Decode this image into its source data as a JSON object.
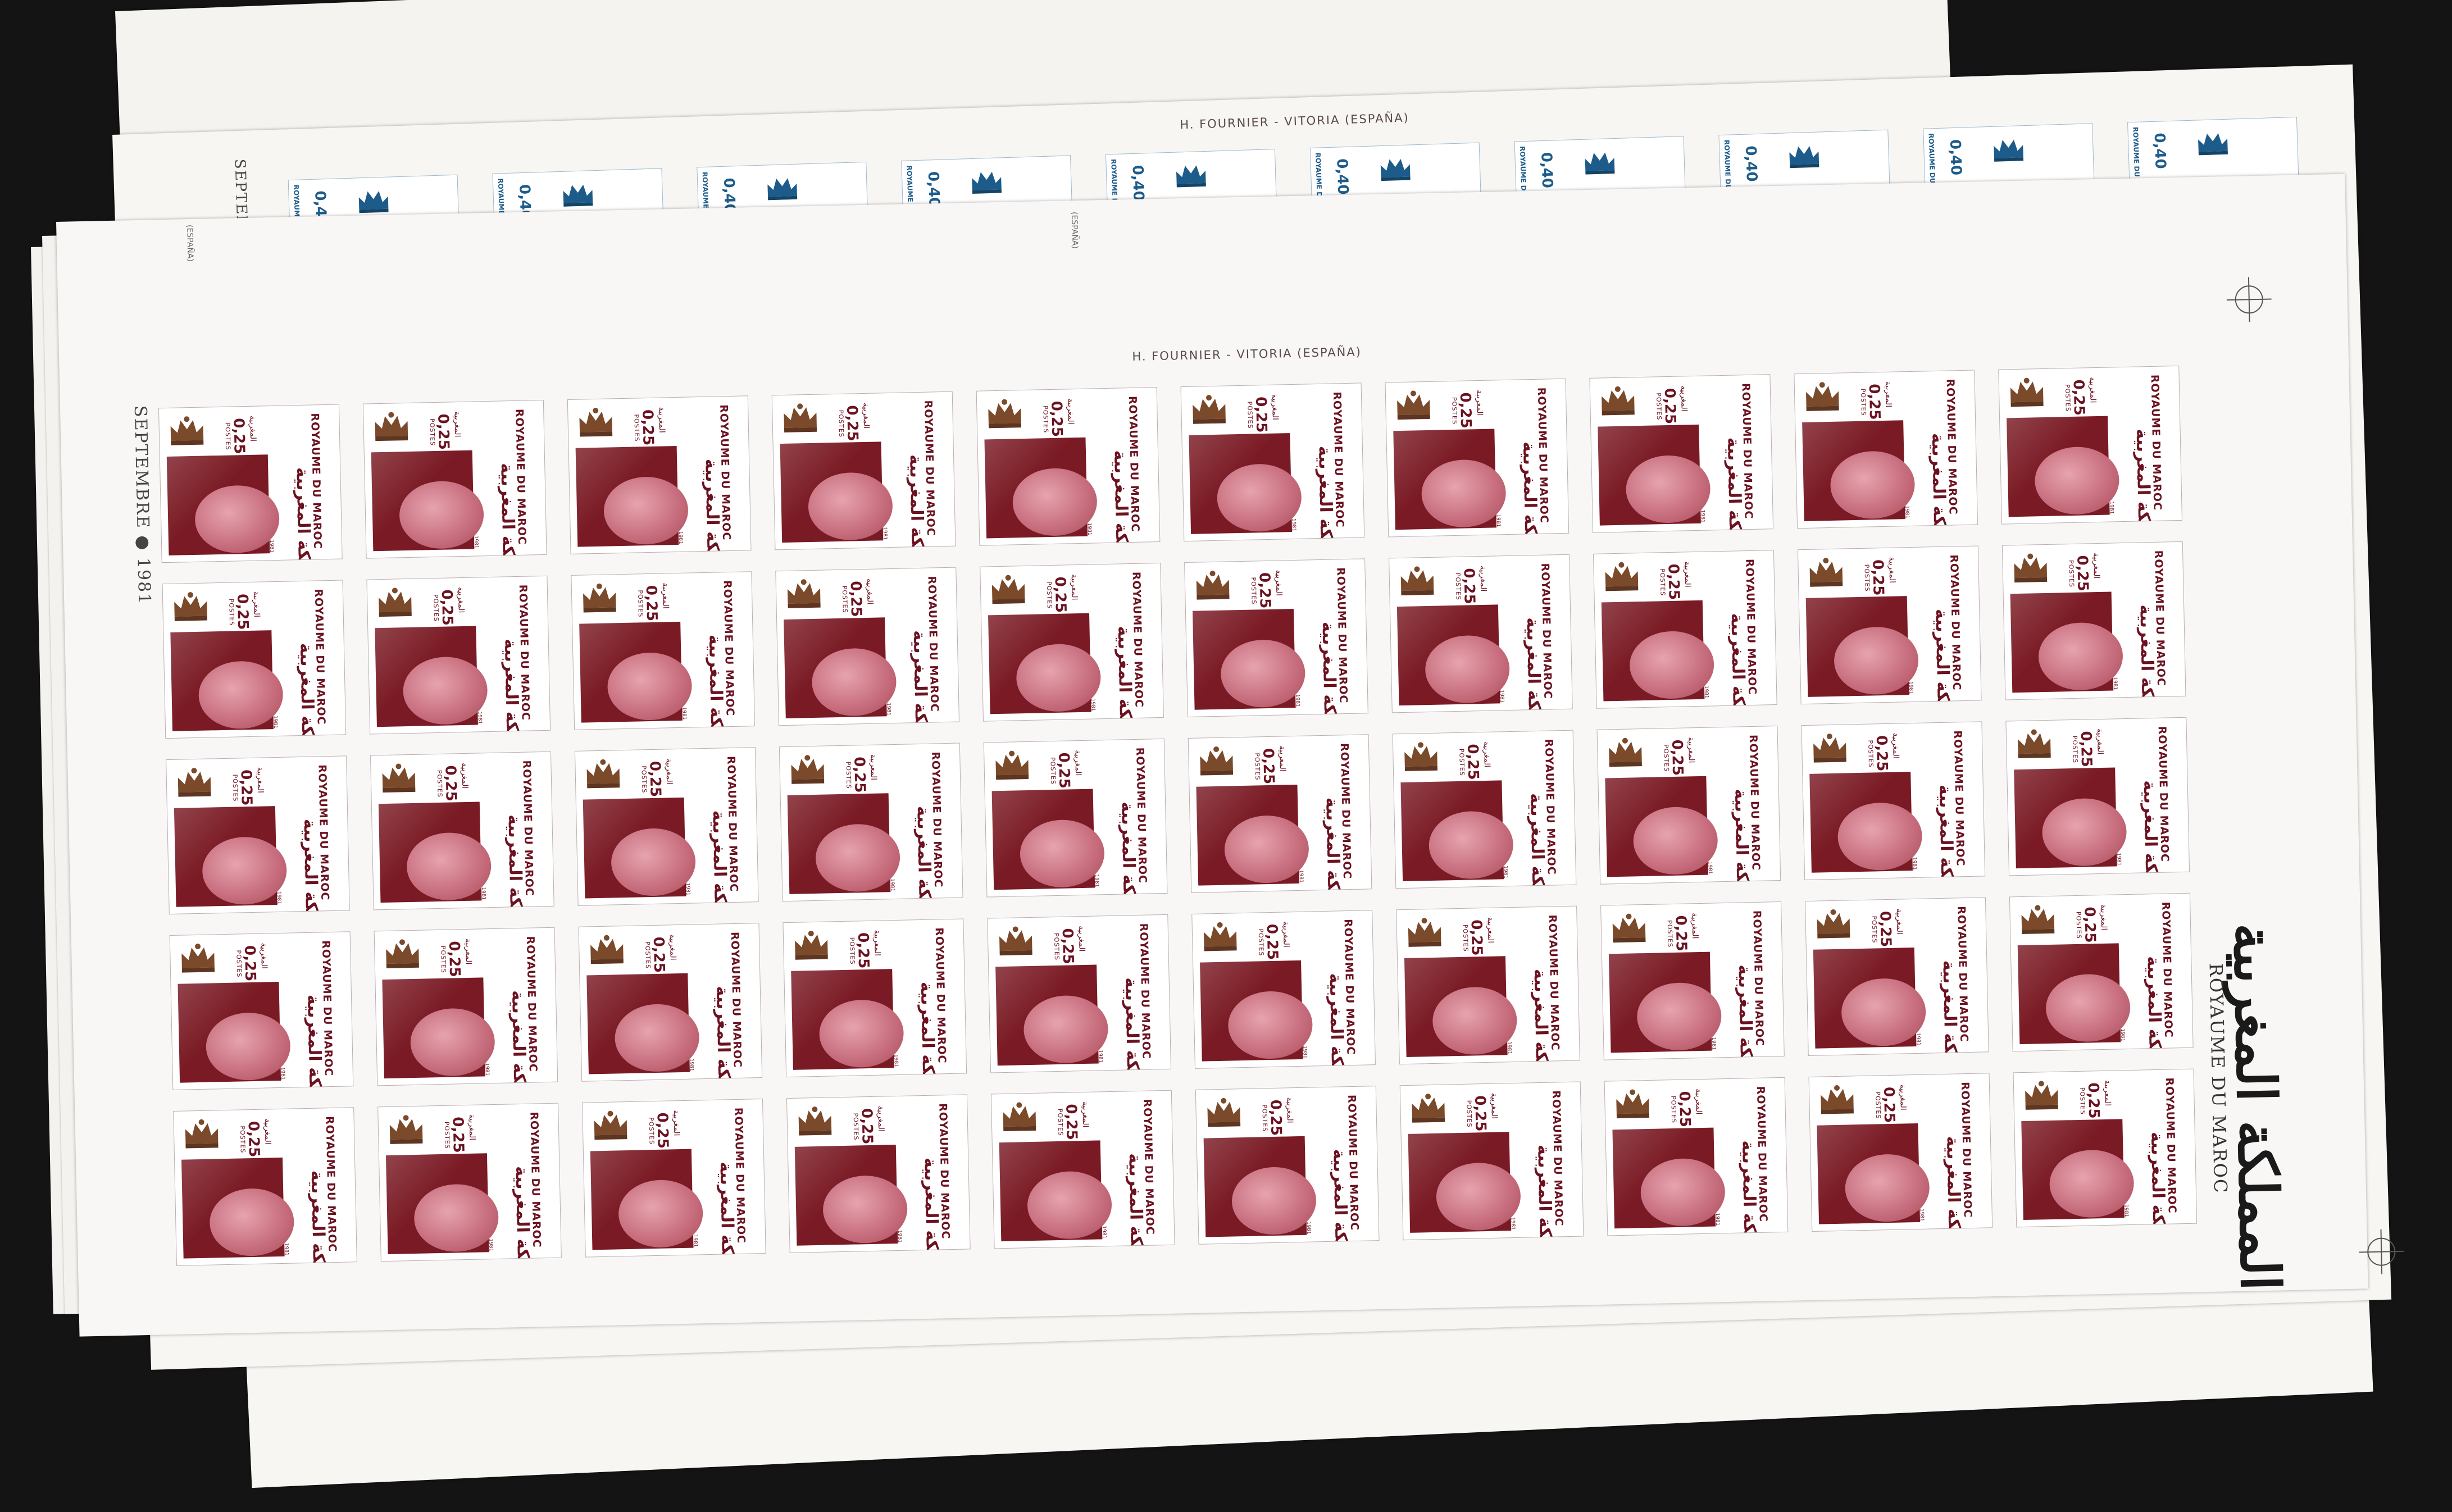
{
  "back_sheet": {
    "printer": "H. FOURNIER - VITORIA (ESPAÑA)",
    "date_margin": "SEPTEMBRE",
    "stamp_value": "0,40",
    "stamp_color": "#1d5c8a",
    "country": "ROYAUME DU MAROC",
    "visible_stamps": 10
  },
  "front_sheet": {
    "printer": "H. FOURNIER - VITORIA (ESPAÑA)",
    "date_margin": "SEPTEMBRE ● 1981",
    "corner_mark": "(ESPAÑA)",
    "margin_arabic": "المملكة المغربية",
    "margin_country": "ROYAUME DU MAROC",
    "rows": 5,
    "columns": 10,
    "stamp": {
      "value": "0,25",
      "postes": "POSTES",
      "country": "ROYAUME DU MAROC",
      "arabic_country": "المملكة المغربية",
      "arabic_currency": "المغربية",
      "year": "1981",
      "primary_color": "#7a1a24",
      "portrait_color": "#c97080",
      "crown_color": "#7a4a2a",
      "crown_icon": "crown-icon"
    }
  }
}
